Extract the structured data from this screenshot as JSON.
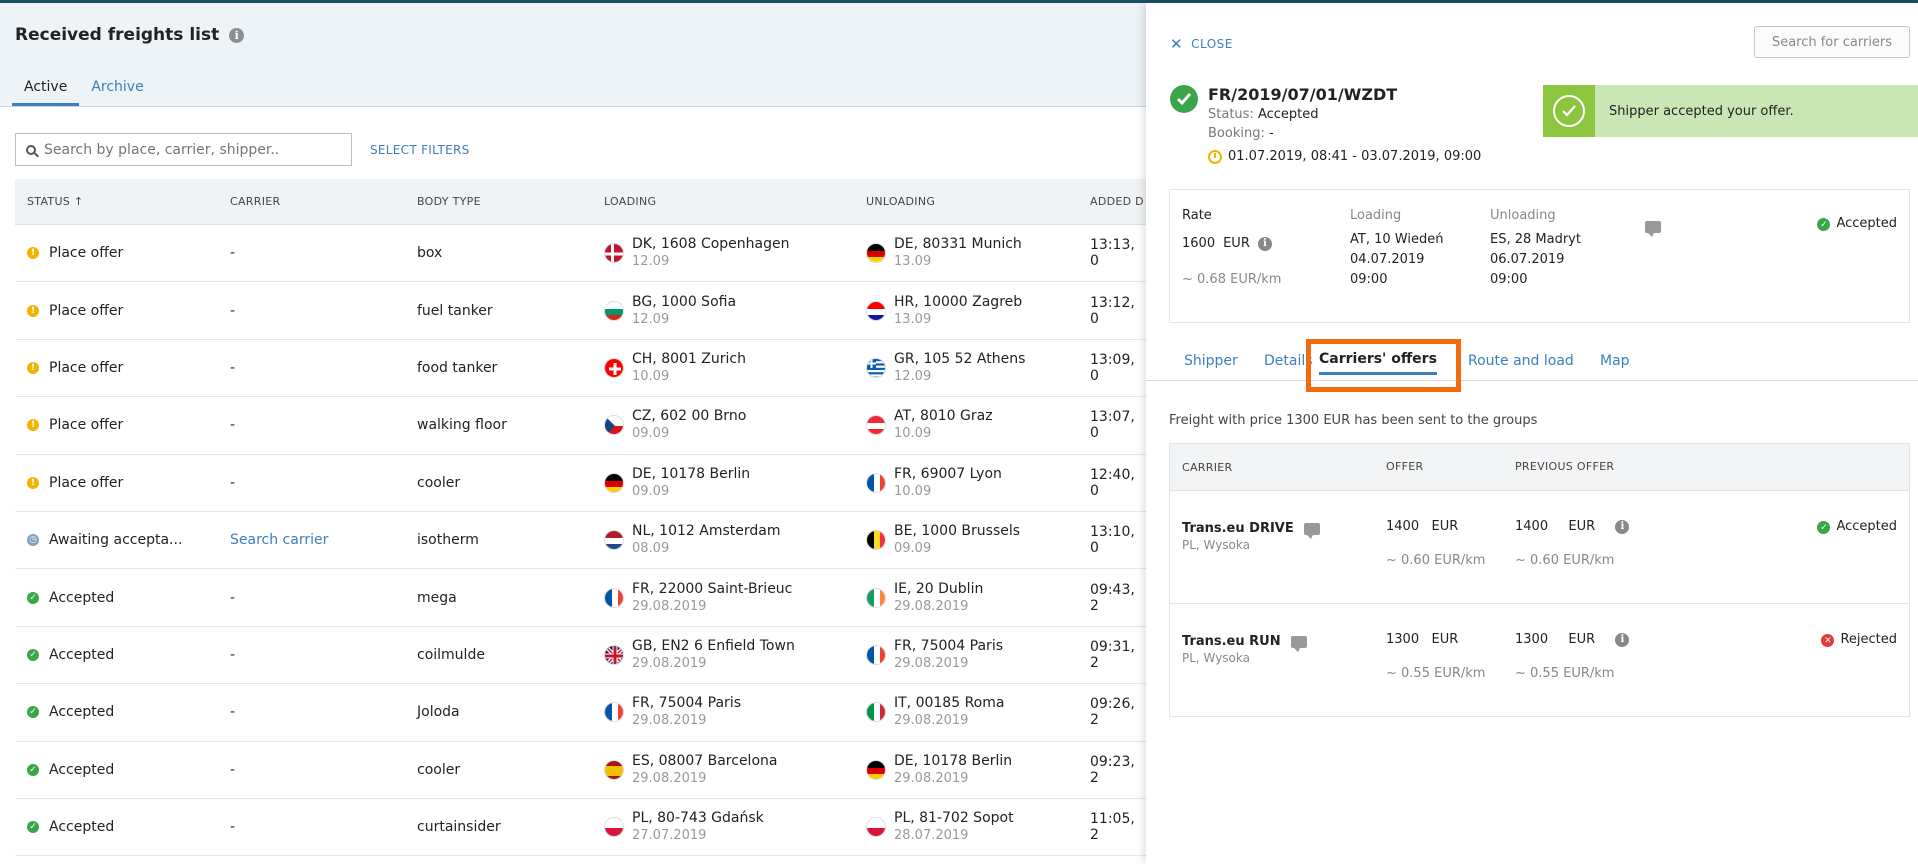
{
  "page": {
    "title": "Received freights list",
    "tabs": [
      {
        "label": "Active"
      },
      {
        "label": "Archive"
      }
    ],
    "search_placeholder": "Search by place, carrier, shipper..",
    "select_filters": "SELECT FILTERS"
  },
  "table": {
    "headers": {
      "status": "STATUS ↑",
      "carrier": "CARRIER",
      "body_type": "BODY TYPE",
      "loading": "LOADING",
      "unloading": "UNLOADING",
      "added": "ADDED D"
    },
    "rows": [
      {
        "status": "Place offer",
        "status_type": "warn",
        "carrier": "-",
        "body": "box",
        "load_flag": "dk",
        "load_place": "DK, 1608 Copenhagen",
        "load_date": "12.09",
        "unload_flag": "de",
        "unload_place": "DE, 80331 Munich",
        "unload_date": "13.09",
        "added": "13:13, 0"
      },
      {
        "status": "Place offer",
        "status_type": "warn",
        "carrier": "-",
        "body": "fuel tanker",
        "load_flag": "bg",
        "load_place": "BG, 1000 Sofia",
        "load_date": "12.09",
        "unload_flag": "hr",
        "unload_place": "HR, 10000 Zagreb",
        "unload_date": "13.09",
        "added": "13:12, 0"
      },
      {
        "status": "Place offer",
        "status_type": "warn",
        "carrier": "-",
        "body": "food tanker",
        "load_flag": "ch",
        "load_place": "CH, 8001 Zurich",
        "load_date": "10.09",
        "unload_flag": "gr",
        "unload_place": "GR, 105 52 Athens",
        "unload_date": "12.09",
        "added": "13:09, 0"
      },
      {
        "status": "Place offer",
        "status_type": "warn",
        "carrier": "-",
        "body": "walking floor",
        "load_flag": "cz",
        "load_place": "CZ, 602 00 Brno",
        "load_date": "09.09",
        "unload_flag": "at",
        "unload_place": "AT, 8010 Graz",
        "unload_date": "10.09",
        "added": "13:07, 0"
      },
      {
        "status": "Place offer",
        "status_type": "warn",
        "carrier": "-",
        "body": "cooler",
        "load_flag": "de",
        "load_place": "DE, 10178 Berlin",
        "load_date": "09.09",
        "unload_flag": "fr",
        "unload_place": "FR, 69007 Lyon",
        "unload_date": "10.09",
        "added": "12:40, 0"
      },
      {
        "status": "Awaiting accepta...",
        "status_type": "wait",
        "carrier": "Search carrier",
        "carrier_link": true,
        "body": "isotherm",
        "load_flag": "nl",
        "load_place": "NL, 1012 Amsterdam",
        "load_date": "08.09",
        "unload_flag": "be",
        "unload_place": "BE, 1000 Brussels",
        "unload_date": "09.09",
        "added": "13:10, 0"
      },
      {
        "status": "Accepted",
        "status_type": "ok",
        "carrier": "-",
        "body": "mega",
        "load_flag": "fr",
        "load_place": "FR, 22000 Saint-Brieuc",
        "load_date": "29.08.2019",
        "unload_flag": "ie",
        "unload_place": "IE, 20 Dublin",
        "unload_date": "29.08.2019",
        "added": "09:43, 2"
      },
      {
        "status": "Accepted",
        "status_type": "ok",
        "carrier": "-",
        "body": "coilmulde",
        "load_flag": "gb",
        "load_place": "GB, EN2 6 Enfield Town",
        "load_date": "29.08.2019",
        "unload_flag": "fr",
        "unload_place": "FR, 75004 Paris",
        "unload_date": "29.08.2019",
        "added": "09:31, 2"
      },
      {
        "status": "Accepted",
        "status_type": "ok",
        "carrier": "-",
        "body": "Joloda",
        "load_flag": "fr",
        "load_place": "FR, 75004 Paris",
        "load_date": "29.08.2019",
        "unload_flag": "it",
        "unload_place": "IT, 00185 Roma",
        "unload_date": "29.08.2019",
        "added": "09:26, 2"
      },
      {
        "status": "Accepted",
        "status_type": "ok",
        "carrier": "-",
        "body": "cooler",
        "load_flag": "es",
        "load_place": "ES, 08007 Barcelona",
        "load_date": "29.08.2019",
        "unload_flag": "de",
        "unload_place": "DE, 10178 Berlin",
        "unload_date": "29.08.2019",
        "added": "09:23, 2"
      },
      {
        "status": "Accepted",
        "status_type": "ok",
        "carrier": "-",
        "body": "curtainsider",
        "load_flag": "pl",
        "load_place": "PL, 80-743 Gdańsk",
        "load_date": "27.07.2019",
        "unload_flag": "pl",
        "unload_place": "PL, 81-702 Sopot",
        "unload_date": "28.07.2019",
        "added": "11:05, 2"
      }
    ]
  },
  "panel": {
    "close": "CLOSE",
    "search_carriers": "Search for carriers",
    "freight_id": "FR/2019/07/01/WZDT",
    "status_label": "Status:",
    "status_value": "Accepted",
    "booking_label": "Booking:",
    "booking_value": "-",
    "time_range": "01.07.2019, 08:41 - 03.07.2019, 09:00",
    "toast": "Shipper accepted your offer.",
    "rate": {
      "label": "Rate",
      "value": "1600",
      "currency": "EUR",
      "per_km": "~ 0.68 EUR/km",
      "loading_label": "Loading",
      "loading_place": "AT, 10 Wiedeń",
      "loading_date": "04.07.2019",
      "loading_time": "09:00",
      "unloading_label": "Unloading",
      "unloading_place": "ES, 28 Madryt",
      "unloading_date": "06.07.2019",
      "unloading_time": "09:00",
      "status": "Accepted"
    },
    "tabs": [
      "Shipper",
      "Details",
      "Carriers' offers",
      "Route and load",
      "Map"
    ],
    "sent_message": "Freight with price 1300 EUR has been sent to the groups",
    "offers_headers": {
      "carrier": "CARRIER",
      "offer": "OFFER",
      "previous": "PREVIOUS OFFER"
    },
    "offers": [
      {
        "name": "Trans.eu DRIVE",
        "loc": "PL, Wysoka",
        "offer": "1400",
        "offer_cur": "EUR",
        "offer_km": "~ 0.60 EUR/km",
        "prev": "1400",
        "prev_cur": "EUR",
        "prev_km": "~ 0.60 EUR/km",
        "status": "Accepted",
        "status_type": "ok"
      },
      {
        "name": "Trans.eu RUN",
        "loc": "PL, Wysoka",
        "offer": "1300",
        "offer_cur": "EUR",
        "offer_km": "~ 0.55 EUR/km",
        "prev": "1300",
        "prev_cur": "EUR",
        "prev_km": "~ 0.55 EUR/km",
        "status": "Rejected",
        "status_type": "no"
      }
    ]
  },
  "colors": {
    "accent": "#3a7fbf",
    "ok": "#3aa64a",
    "warn": "#f1b400",
    "highlight": "#f26b10",
    "toast_bg": "#c8e7b4"
  }
}
